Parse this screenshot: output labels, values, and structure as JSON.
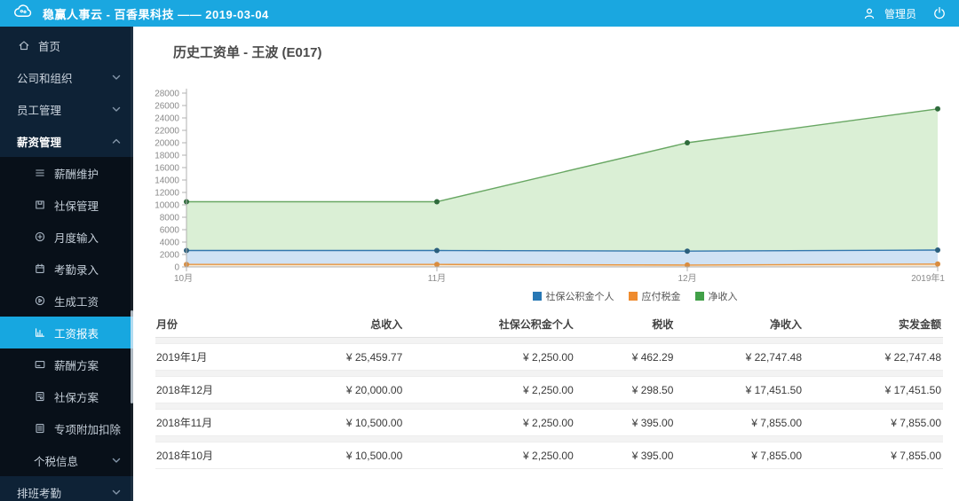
{
  "topbar": {
    "title": "稳赢人事云 - 百香果科技 —— 2019-03-04",
    "user": "管理员"
  },
  "page": {
    "title": "历史工资单 - 王波 (E017)"
  },
  "sidebar": {
    "items": [
      {
        "id": "home",
        "label": "首页",
        "icon": "home-icon",
        "type": "link"
      },
      {
        "id": "company-organization",
        "label": "公司和组织",
        "chevron": "down",
        "type": "group"
      },
      {
        "id": "employee-management",
        "label": "员工管理",
        "chevron": "down",
        "type": "group"
      },
      {
        "id": "salary-management",
        "label": "薪资管理",
        "chevron": "up",
        "type": "group",
        "expanded": true
      },
      {
        "id": "salary-maintenance",
        "label": "薪酬维护",
        "icon": "list-icon",
        "type": "sub"
      },
      {
        "id": "social-security-mgmt",
        "label": "社保管理",
        "icon": "save-icon",
        "type": "sub"
      },
      {
        "id": "monthly-input",
        "label": "月度输入",
        "icon": "plus-circle-icon",
        "type": "sub"
      },
      {
        "id": "attendance-entry",
        "label": "考勤录入",
        "icon": "calendar-icon",
        "type": "sub"
      },
      {
        "id": "generate-salary",
        "label": "生成工资",
        "icon": "play-circle-icon",
        "type": "sub"
      },
      {
        "id": "salary-report",
        "label": "工资报表",
        "icon": "bar-chart-icon",
        "type": "sub",
        "active": true
      },
      {
        "id": "salary-plan",
        "label": "薪酬方案",
        "icon": "card-icon",
        "type": "sub"
      },
      {
        "id": "social-security-plan",
        "label": "社保方案",
        "icon": "doc-icon",
        "type": "sub"
      },
      {
        "id": "special-deduction",
        "label": "专项附加扣除",
        "icon": "doc-lines-icon",
        "type": "sub"
      },
      {
        "id": "tax-info",
        "label": "个税信息",
        "chevron": "down",
        "type": "sub-group"
      },
      {
        "id": "shift-attendance",
        "label": "排班考勤",
        "chevron": "down",
        "type": "group"
      }
    ]
  },
  "chart_data": {
    "type": "area",
    "stacked": true,
    "x": [
      "10月",
      "11月",
      "12月",
      "2019年1"
    ],
    "series": [
      {
        "id": "tax",
        "name": "应付税金",
        "values": [
          395,
          395,
          298.5,
          462.29
        ],
        "line": "#e8953f",
        "fill": "#f7ead6",
        "dot": "#d98c3f",
        "swatch": "#ef8b2e"
      },
      {
        "id": "social",
        "name": "社保公积金个人",
        "values": [
          2250,
          2250,
          2250,
          2250
        ],
        "line": "#3377ae",
        "fill": "#d0e2f4",
        "dot": "#2b5f7d",
        "swatch": "#2878b5"
      },
      {
        "id": "net",
        "name": "净收入",
        "values": [
          7855,
          7855,
          17451.5,
          22747.48
        ],
        "line": "#68a763",
        "fill": "#daefd5",
        "dot": "#2f6b3c",
        "swatch": "#41a048"
      }
    ],
    "legend": [
      {
        "series": "social",
        "label": "社保公积金个人"
      },
      {
        "series": "tax",
        "label": "应付税金"
      },
      {
        "series": "net",
        "label": "净收入"
      }
    ],
    "ylim": [
      0,
      28000
    ],
    "ytick_step": 2000,
    "grid": false,
    "legend_position": "bottom"
  },
  "table": {
    "columns": [
      "月份",
      "总收入",
      "社保公积金个人",
      "税收",
      "净收入",
      "实发金额"
    ],
    "column_ids": [
      "month",
      "total-income",
      "social-security-personal",
      "tax",
      "net-income",
      "paid-amount"
    ],
    "rows": [
      [
        "2019年1月",
        "¥ 25,459.77",
        "¥ 2,250.00",
        "¥ 462.29",
        "¥ 22,747.48",
        "¥ 22,747.48"
      ],
      [
        "2018年12月",
        "¥ 20,000.00",
        "¥ 2,250.00",
        "¥ 298.50",
        "¥ 17,451.50",
        "¥ 17,451.50"
      ],
      [
        "2018年11月",
        "¥ 10,500.00",
        "¥ 2,250.00",
        "¥ 395.00",
        "¥ 7,855.00",
        "¥ 7,855.00"
      ],
      [
        "2018年10月",
        "¥ 10,500.00",
        "¥ 2,250.00",
        "¥ 395.00",
        "¥ 7,855.00",
        "¥ 7,855.00"
      ]
    ]
  }
}
